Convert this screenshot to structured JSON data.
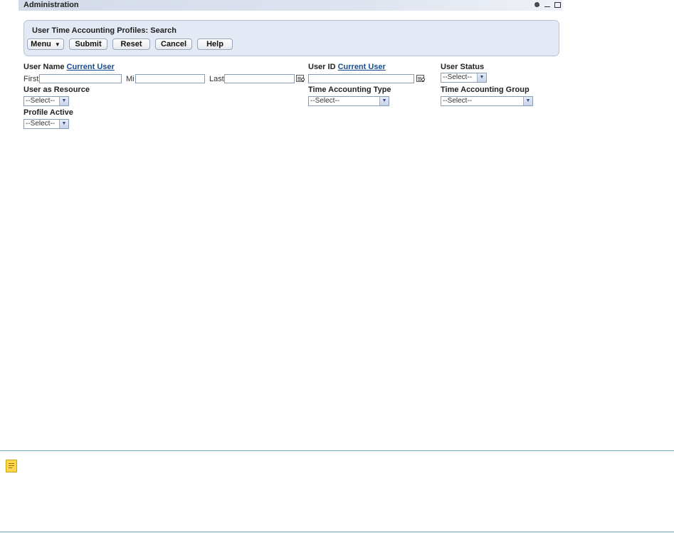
{
  "window": {
    "title": "Administration"
  },
  "search_panel": {
    "title": "User Time Accounting Profiles: Search",
    "buttons": {
      "menu": "Menu",
      "menu_arrow": "▼",
      "submit": "Submit",
      "reset": "Reset",
      "cancel": "Cancel",
      "help": "Help"
    }
  },
  "form": {
    "user_name": {
      "label": "User Name",
      "link": "Current User",
      "first_label": "First",
      "mi_label": "Mi",
      "last_label": "Last",
      "first_value": "",
      "mi_value": "",
      "last_value": ""
    },
    "user_id": {
      "label": "User ID",
      "link": "Current User",
      "value": ""
    },
    "user_status": {
      "label": "User Status",
      "selected": "--Select--"
    },
    "user_as_resource": {
      "label": "User as Resource",
      "selected": "--Select--"
    },
    "time_accounting_type": {
      "label": "Time Accounting Type",
      "selected": "--Select--"
    },
    "time_accounting_group": {
      "label": "Time Accounting Group",
      "selected": "--Select--"
    },
    "profile_active": {
      "label": "Profile Active",
      "selected": "--Select--"
    }
  },
  "icons": {
    "settings": "gear-icon",
    "minimize": "minimize-icon",
    "maximize": "maximize-icon",
    "lookup": "lookup-icon",
    "dropdown": "chevron-down-icon",
    "note": "note-icon"
  },
  "colors": {
    "title_bar": "#d4dbe9",
    "panel_bg": "#e3eaf5",
    "link": "#1a4d8f",
    "divider": "#6fa7b8",
    "note": "#ffd84d"
  }
}
